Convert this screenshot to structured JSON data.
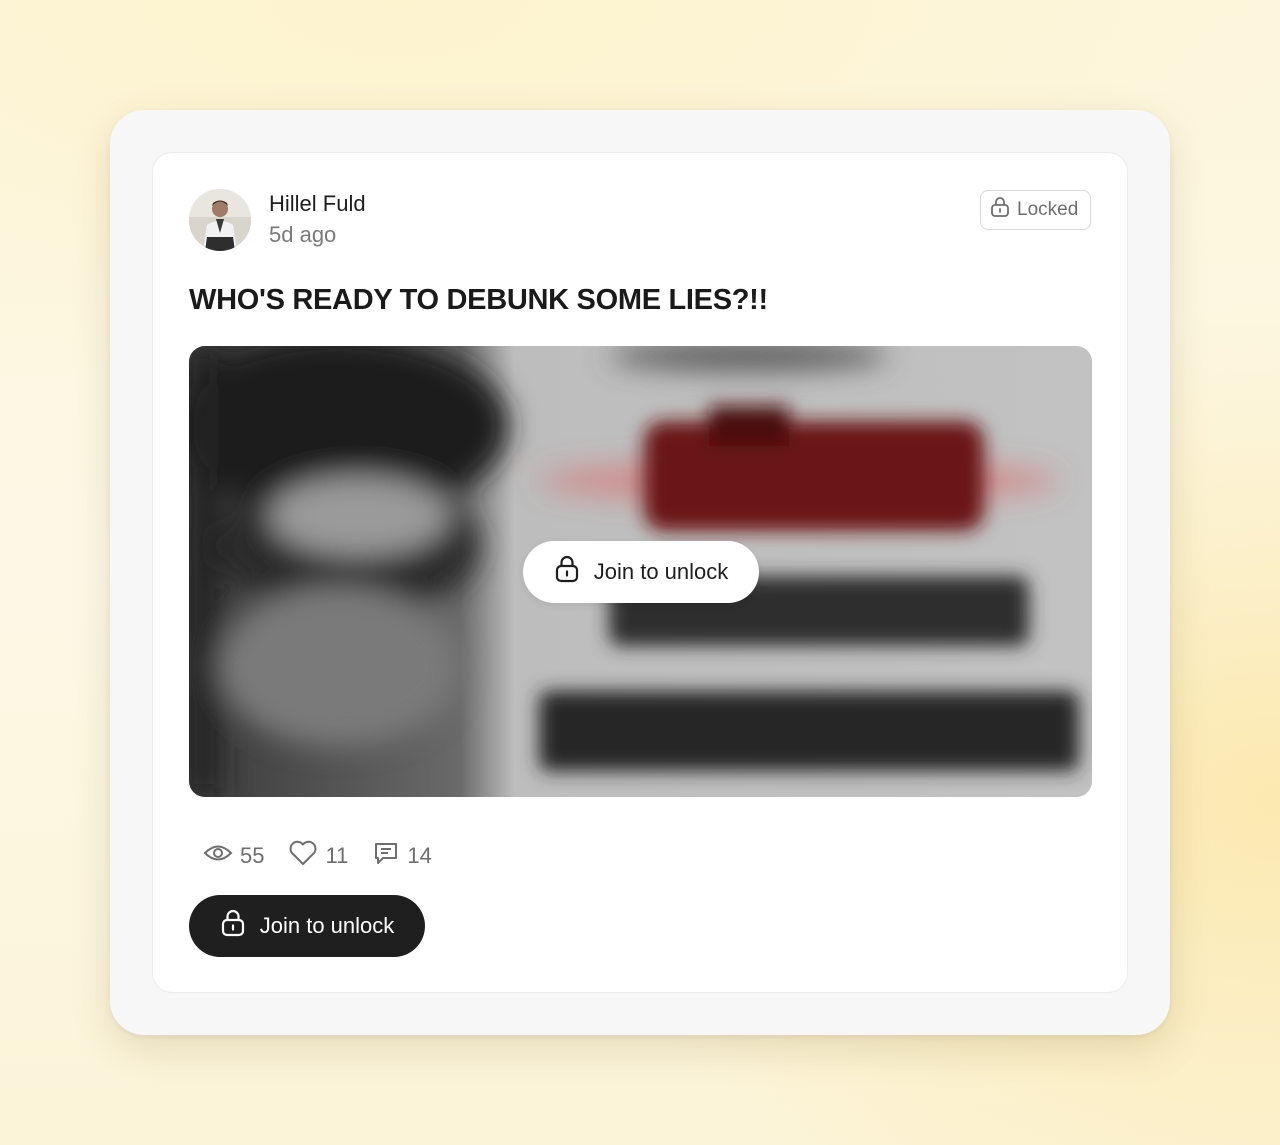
{
  "post": {
    "author": "Hillel Fuld",
    "time": "5d ago",
    "badge": "Locked",
    "title": "WHO'S READY TO DEBUNK SOME LIES?!!",
    "media_overlay_label": "Join to unlock",
    "cta_label": "Join to unlock"
  },
  "stats": {
    "views": "55",
    "likes": "11",
    "comments": "14"
  },
  "icons": {
    "avatar": "author-avatar",
    "badge": "lock-icon",
    "views": "eye-icon",
    "likes": "heart-icon",
    "comments": "comment-icon"
  },
  "colors": {
    "cta_background": "#1f1f1f",
    "media_red": "#8b1a1a"
  }
}
